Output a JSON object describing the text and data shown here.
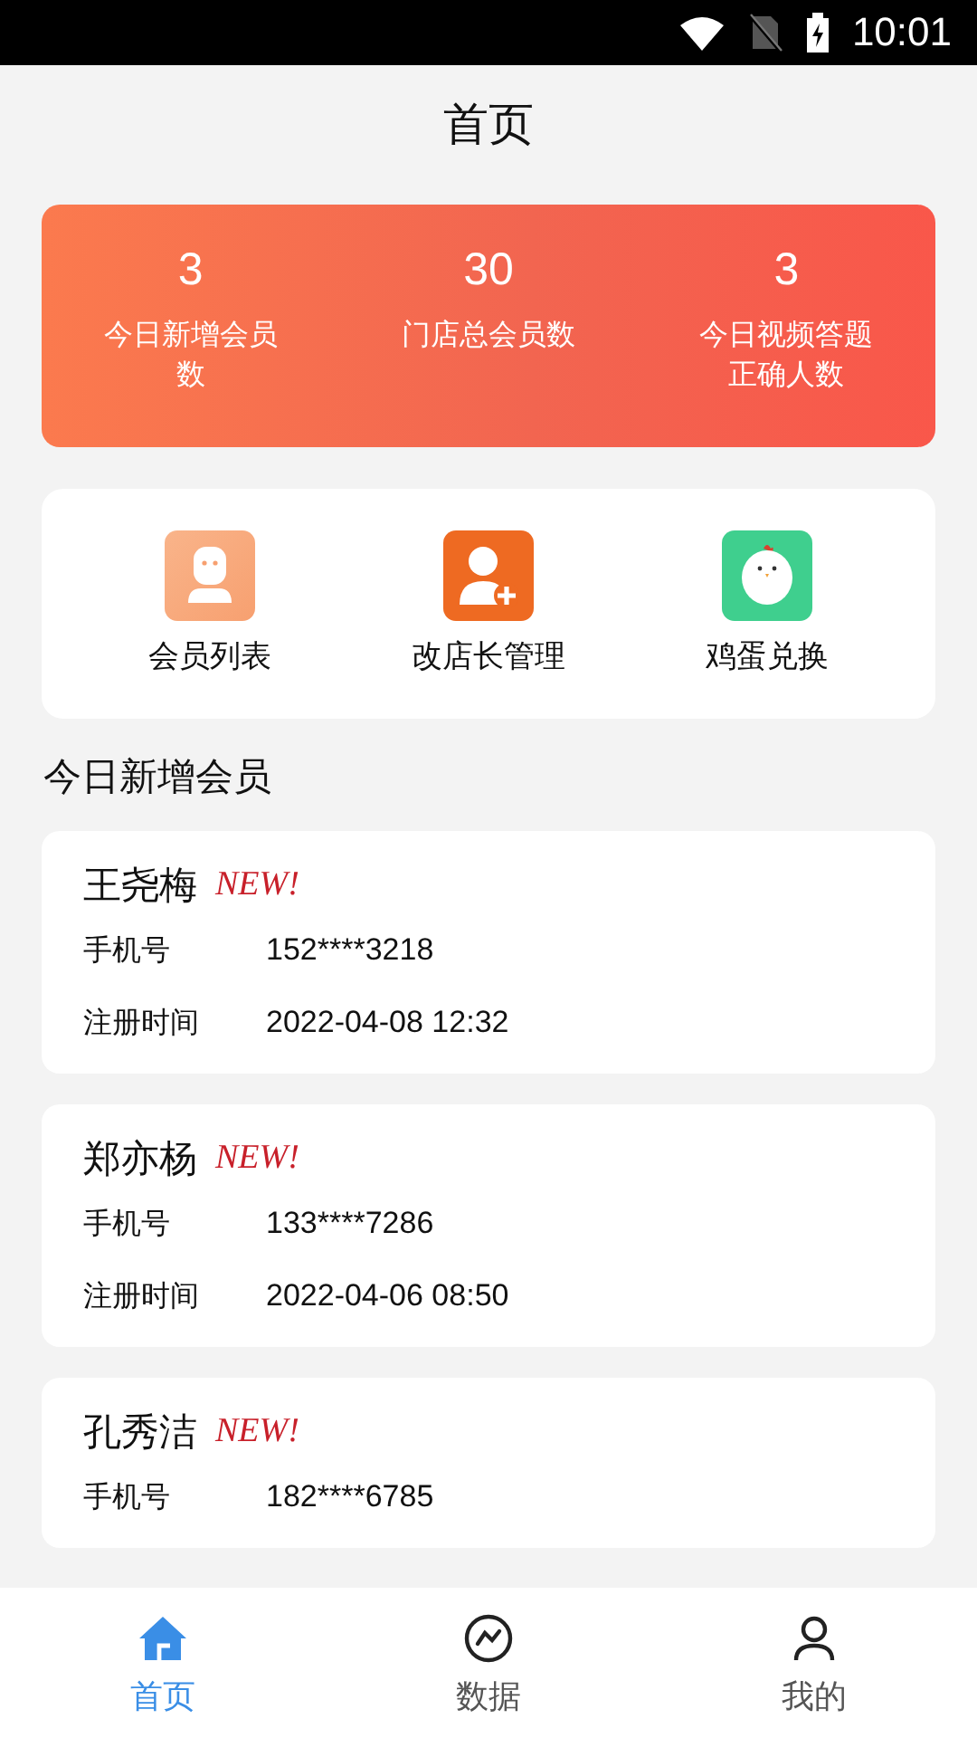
{
  "status_bar": {
    "time": "10:01"
  },
  "header": {
    "title": "首页"
  },
  "stats": [
    {
      "value": "3",
      "label": "今日新增会员数"
    },
    {
      "value": "30",
      "label": "门店总会员数"
    },
    {
      "value": "3",
      "label": "今日视频答题正确人数"
    }
  ],
  "shortcuts": [
    {
      "label": "会员列表"
    },
    {
      "label": "改店长管理"
    },
    {
      "label": "鸡蛋兑换"
    }
  ],
  "section_title": "今日新增会员",
  "members": [
    {
      "name": "王尧梅",
      "badge": "NEW!",
      "fields": [
        {
          "label": "手机号",
          "value": "152****3218"
        },
        {
          "label": "注册时间",
          "value": "2022-04-08 12:32"
        }
      ]
    },
    {
      "name": "郑亦杨",
      "badge": "NEW!",
      "fields": [
        {
          "label": "手机号",
          "value": "133****7286"
        },
        {
          "label": "注册时间",
          "value": "2022-04-06 08:50"
        }
      ]
    },
    {
      "name": "孔秀洁",
      "badge": "NEW!",
      "fields": [
        {
          "label": "手机号",
          "value": "182****6785"
        }
      ]
    }
  ],
  "tabs": [
    {
      "label": "首页",
      "selected": true
    },
    {
      "label": "数据",
      "selected": false
    },
    {
      "label": "我的",
      "selected": false
    }
  ]
}
